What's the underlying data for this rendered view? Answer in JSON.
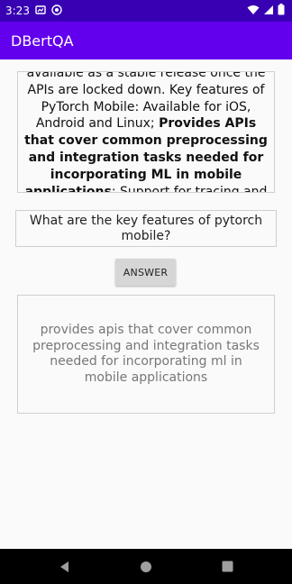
{
  "status_bar": {
    "time": "3:23"
  },
  "app_bar": {
    "title": "DBertQA"
  },
  "context": {
    "part1": "available as a stable release once the APIs are locked down. Key features of PyTorch Mobile: Available for iOS, Android and Linux; ",
    "bold": "Provides APIs that cover common preprocessing and integration tasks needed for incorporating ML in mobile applications",
    "part2": "; Support for tracing and scripting via TorchScript IR; Support for"
  },
  "question": {
    "value": "What are the key features of pytorch mobile?"
  },
  "answer_button": {
    "label": "ANSWER"
  },
  "answer": {
    "value": "provides apis that cover common preprocessing and integration tasks needed for incorporating ml in mobile applications"
  }
}
